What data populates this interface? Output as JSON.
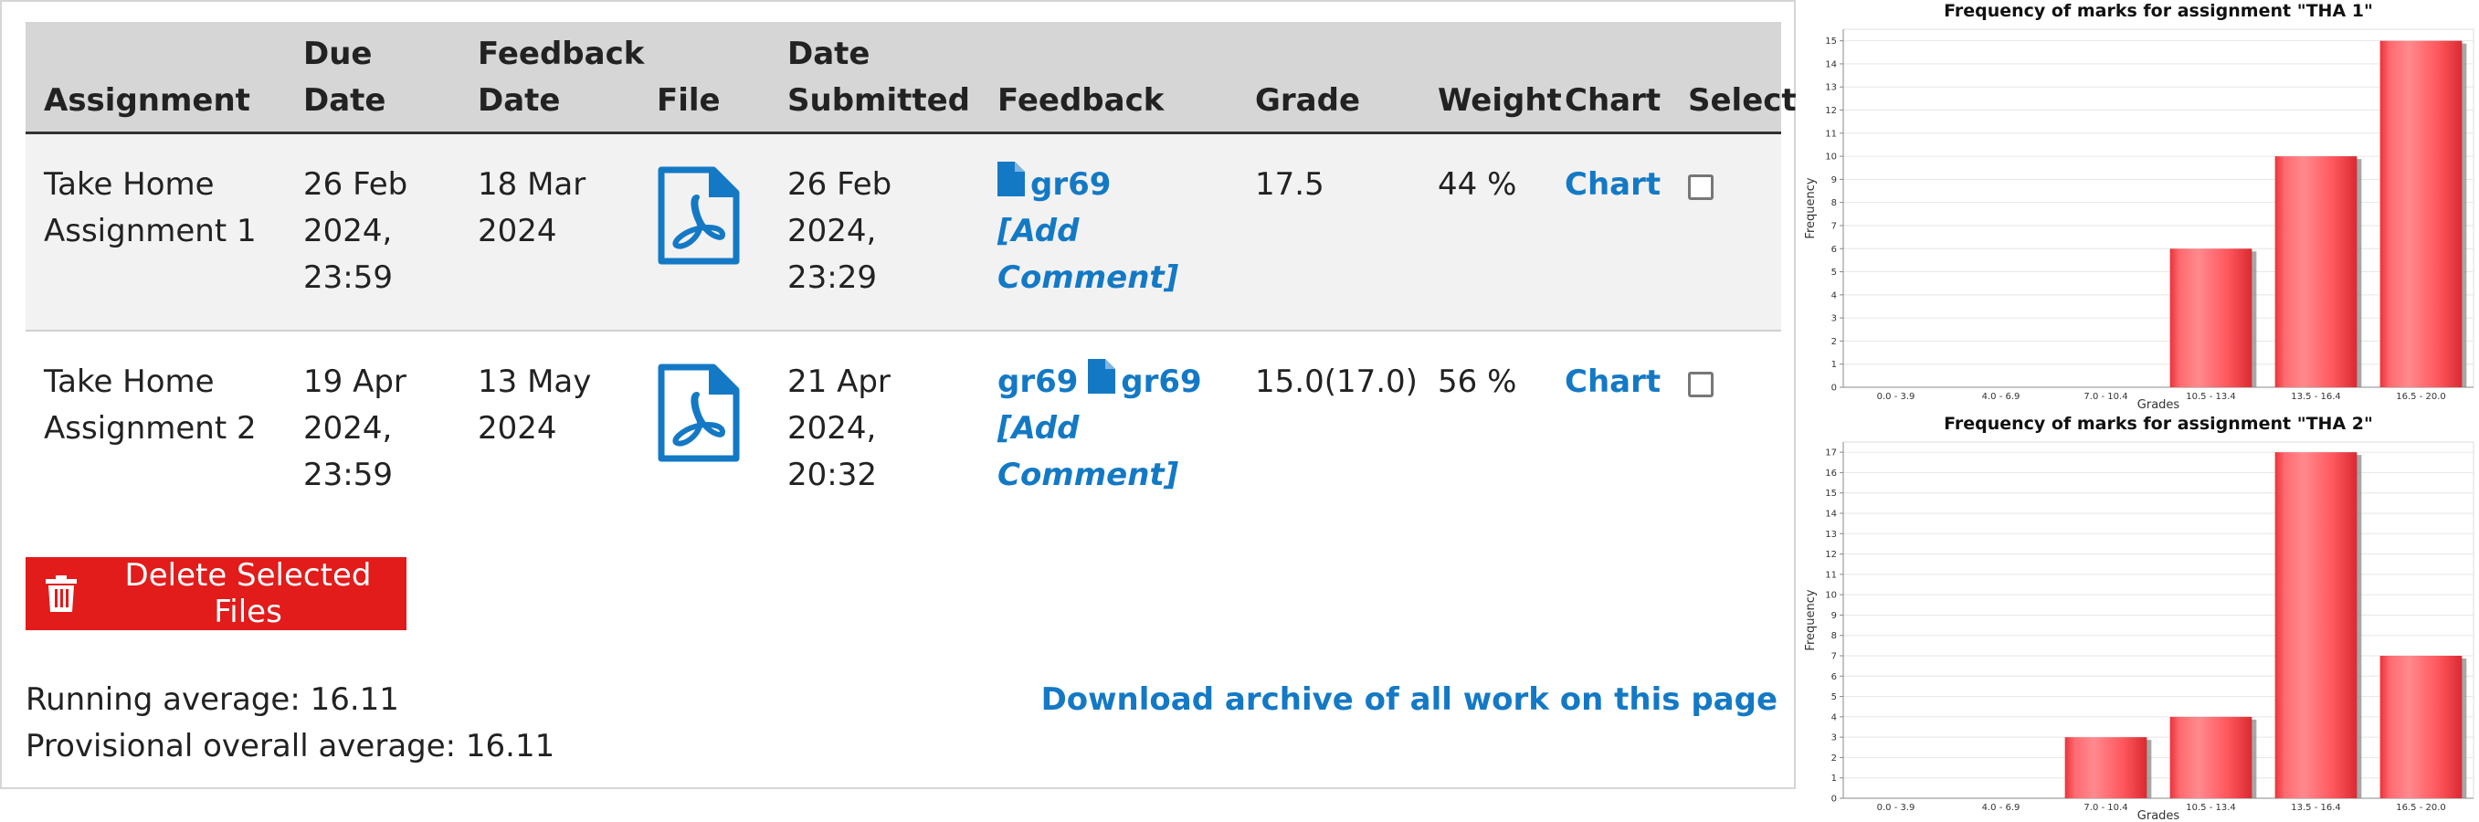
{
  "table": {
    "headers": {
      "assignment": "Assignment",
      "due_date_line1": "Due Date",
      "feedback_date_line1": "Feedback",
      "feedback_date_line2": "Date",
      "file": "File",
      "date_submitted_line1": "Date",
      "date_submitted_line2": "Submitted",
      "feedback": "Feedback",
      "grade": "Grade",
      "weight": "Weight",
      "chart": "Chart",
      "select": "Select"
    },
    "rows": [
      {
        "assignment_line1": "Take Home",
        "assignment_line2": "Assignment 1",
        "due_line1": "26 Feb",
        "due_line2": "2024,",
        "due_line3": "23:59",
        "feedback_date_line1": "18 Mar",
        "feedback_date_line2": "2024",
        "file_icon": "pdf-icon",
        "submitted_line1": "26 Feb",
        "submitted_line2": "2024,",
        "submitted_line3": "23:29",
        "feedback_link_plain": "",
        "feedback_link_doc": "gr69",
        "add_comment_line1": "[Add",
        "add_comment_line2": "Comment]",
        "grade": "17.5",
        "weight": "44 %",
        "chart_link": "Chart",
        "selected": false
      },
      {
        "assignment_line1": "Take Home",
        "assignment_line2": "Assignment 2",
        "due_line1": "19 Apr",
        "due_line2": "2024,",
        "due_line3": "23:59",
        "feedback_date_line1": "13 May",
        "feedback_date_line2": "2024",
        "file_icon": "pdf-icon",
        "submitted_line1": "21 Apr",
        "submitted_line2": "2024,",
        "submitted_line3": "20:32",
        "feedback_link_plain": "gr69",
        "feedback_link_doc": "gr69",
        "add_comment_line1": "[Add",
        "add_comment_line2": "Comment]",
        "grade": "15.0(17.0)",
        "weight": "56 %",
        "chart_link": "Chart",
        "selected": false
      }
    ]
  },
  "actions": {
    "delete_label": "Delete Selected Files",
    "download_label": "Download archive of all work on this page"
  },
  "averages": {
    "running": "Running average: 16.11",
    "provisional": "Provisional overall average: 16.11"
  },
  "colors": {
    "link": "#1479c5",
    "delete_button": "#e21b1b",
    "header_bg": "#d6d6d6",
    "bar": "#ff5a5f"
  },
  "chart_data": [
    {
      "type": "bar",
      "title": "Frequency of marks for assignment \"THA 1\"",
      "xlabel": "Grades",
      "ylabel": "Frequency",
      "categories": [
        "0.0 - 3.9",
        "4.0 - 6.9",
        "7.0 - 10.4",
        "10.5 - 13.4",
        "13.5 - 16.4",
        "16.5 - 20.0"
      ],
      "values": [
        0,
        0,
        0,
        6,
        10,
        15
      ],
      "ylim": [
        0,
        15.5
      ],
      "yticks": [
        0,
        1,
        2,
        3,
        4,
        5,
        6,
        7,
        8,
        9,
        10,
        11,
        12,
        13,
        14,
        15
      ],
      "grid": true
    },
    {
      "type": "bar",
      "title": "Frequency of marks for assignment \"THA 2\"",
      "xlabel": "Grades",
      "ylabel": "Frequency",
      "categories": [
        "0.0 - 3.9",
        "4.0 - 6.9",
        "7.0 - 10.4",
        "10.5 - 13.4",
        "13.5 - 16.4",
        "16.5 - 20.0"
      ],
      "values": [
        0,
        0,
        3,
        4,
        17,
        7
      ],
      "ylim": [
        0,
        17.5
      ],
      "yticks": [
        0,
        1,
        2,
        3,
        4,
        5,
        6,
        7,
        8,
        9,
        10,
        11,
        12,
        13,
        14,
        15,
        16,
        17
      ],
      "grid": true
    }
  ]
}
